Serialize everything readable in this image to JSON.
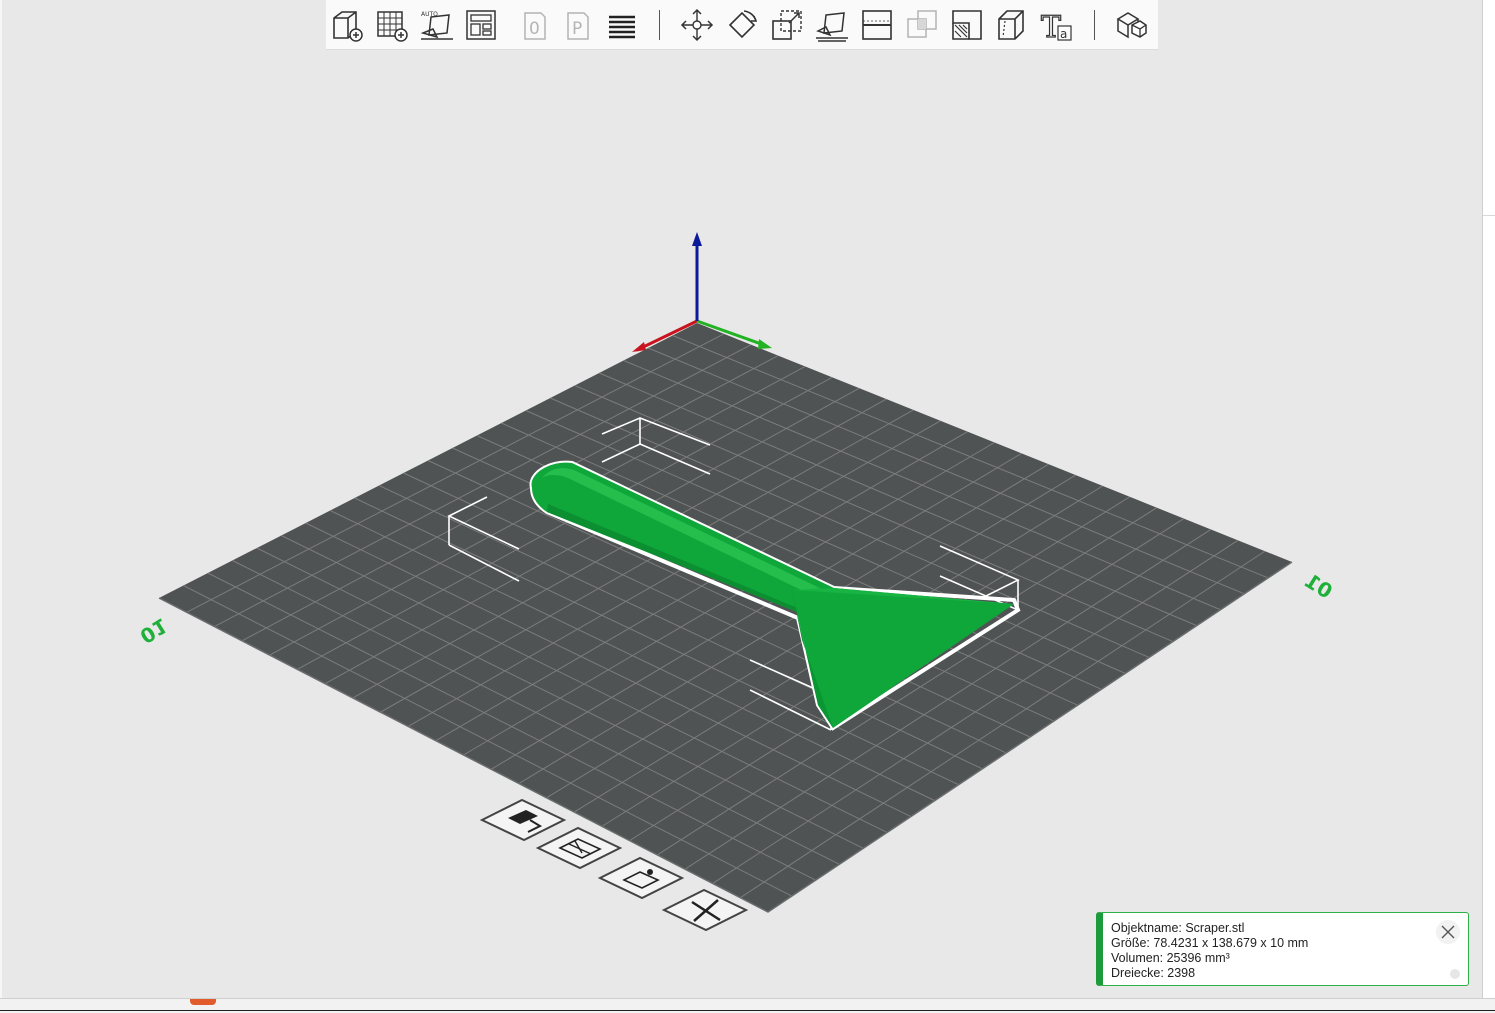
{
  "toolbar": {
    "items": [
      {
        "name": "add-model-icon",
        "enabled": true
      },
      {
        "name": "add-plate-grid-icon",
        "enabled": true
      },
      {
        "name": "auto-orient-icon",
        "label": "AUTO",
        "enabled": true
      },
      {
        "name": "arrange-icon",
        "enabled": true
      },
      {
        "name": "plate-o-icon",
        "label": "0",
        "enabled": false
      },
      {
        "name": "plate-p-icon",
        "label": "P",
        "enabled": false
      },
      {
        "name": "layers-icon",
        "enabled": true
      },
      {
        "name": "move-icon",
        "enabled": true
      },
      {
        "name": "rotate-icon",
        "enabled": true
      },
      {
        "name": "scale-icon",
        "enabled": true
      },
      {
        "name": "lay-on-face-icon",
        "enabled": true
      },
      {
        "name": "cut-icon",
        "enabled": true
      },
      {
        "name": "boolean-icon",
        "enabled": false
      },
      {
        "name": "support-paint-icon",
        "enabled": true
      },
      {
        "name": "seam-paint-icon",
        "enabled": true
      },
      {
        "name": "text-icon",
        "label": "T",
        "sublabel": "a",
        "enabled": true
      },
      {
        "name": "assembly-icon",
        "enabled": true
      }
    ]
  },
  "bed": {
    "label_left": "01",
    "label_right": "01",
    "surface_color": "#505353",
    "grid_color": "#7c7c7c",
    "label_color": "#1fb03a"
  },
  "model": {
    "color": "#0fa63a",
    "highlight_color": "#2ec554"
  },
  "axes": {
    "x_color": "#c8141e",
    "y_color": "#22b322",
    "z_color": "#0a1a9a"
  },
  "plate_buttons": [
    {
      "name": "plate-select-icon"
    },
    {
      "name": "plate-arrange-icon"
    },
    {
      "name": "plate-settings-icon"
    },
    {
      "name": "plate-delete-icon"
    }
  ],
  "info": {
    "object_name": "Objektname: Scraper.stl",
    "size": "Größe: 78.4231 x 138.679 x 10 mm",
    "volume": "Volumen: 25396 mm³",
    "triangles": "Dreiecke: 2398",
    "accent_color": "#1d9b3c"
  }
}
